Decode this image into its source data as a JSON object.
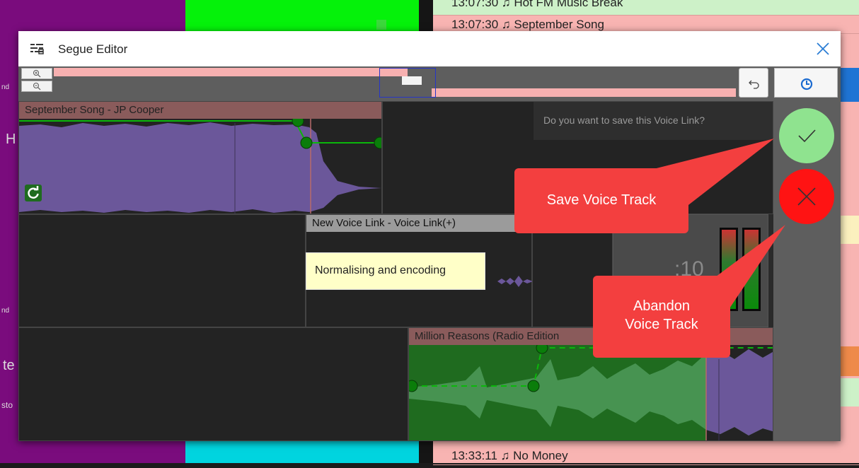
{
  "background": {
    "rows": [
      {
        "text": "13:07:30   ♫  Hot FM Music Break"
      },
      {
        "text": "13:07:30   ♫  September Song"
      },
      {
        "text": "13:33:11   ♫  No Money"
      }
    ],
    "left_fragments": [
      "nd",
      "H",
      "nd",
      "te",
      "sto"
    ]
  },
  "dialog": {
    "title": "Segue Editor",
    "title_icon": "segue-editor-icon",
    "close_icon": "close-icon",
    "toolbar": {
      "zoom_in_icon": "zoom-in-icon",
      "zoom_out_icon": "zoom-out-icon",
      "undo_icon": "undo-icon",
      "timer_icon": "timer-icon"
    },
    "prompt": "Do you want to save this Voice Link?",
    "tracks": {
      "track1": {
        "title": "September Song - JP Cooper",
        "loop_icon": "refresh-icon"
      },
      "voice_link": {
        "title": "New Voice Link - Voice Link(+)"
      },
      "track3": {
        "title": "Million Reasons (Radio Edition"
      }
    },
    "status_tooltip": "Normalising and encoding",
    "meter_readout": ":10",
    "save_icon": "check-icon",
    "abandon_icon": "x-icon"
  },
  "callouts": {
    "save": "Save Voice Track",
    "abandon_line1": "Abandon",
    "abandon_line2": "Voice Track"
  },
  "colors": {
    "waveform_purple": "#6b579a",
    "waveform_green": "#1f6b1f",
    "envelope_green": "#0bb70b",
    "save_green": "#8fe38f",
    "abandon_red": "#ff1313",
    "callout_red": "#f33f3f",
    "tooltip_yellow": "#ffffc8"
  }
}
